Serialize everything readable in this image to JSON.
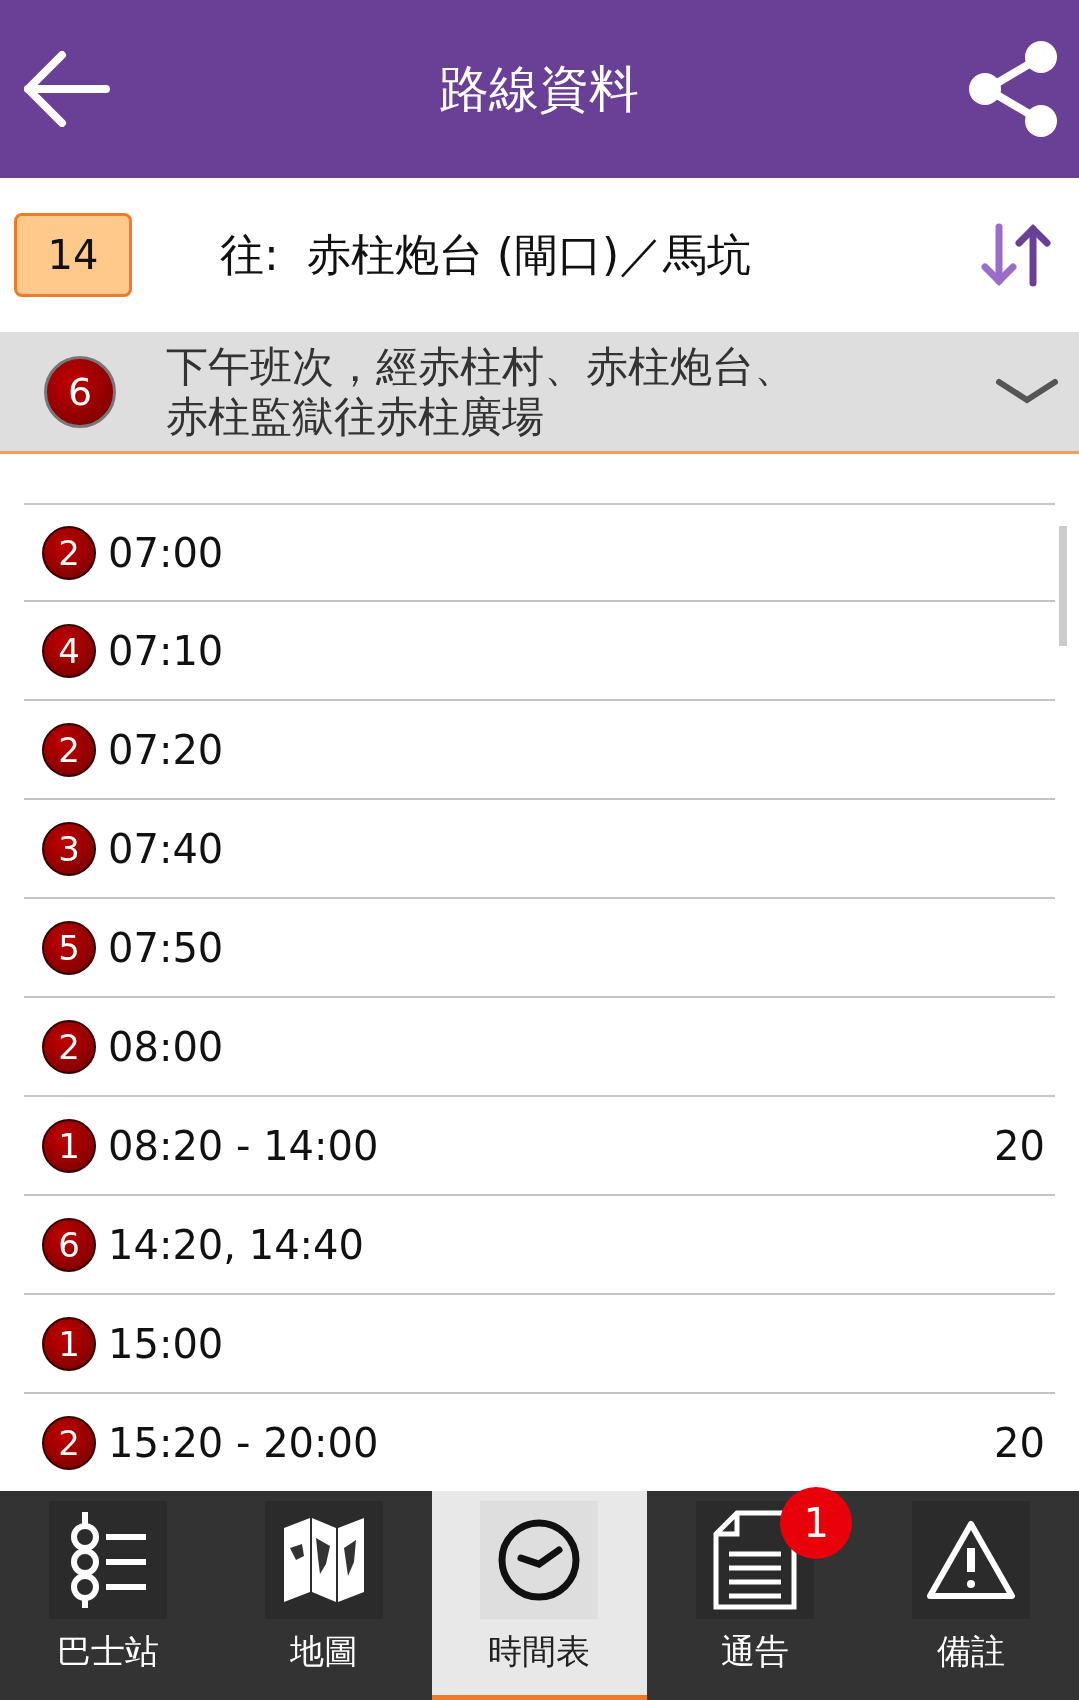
{
  "header": {
    "title": "路線資料"
  },
  "route": {
    "number": "14",
    "destination": "往:  赤柱炮台 (閘口)／馬坑"
  },
  "variant": {
    "number": "6",
    "description": [
      "下午班次，經赤柱村、赤柱炮台、",
      "赤柱監獄往赤柱廣場"
    ]
  },
  "schedule": [
    {
      "variant": "2",
      "times": "07:00"
    },
    {
      "variant": "4",
      "times": "07:10"
    },
    {
      "variant": "2",
      "times": "07:20"
    },
    {
      "variant": "3",
      "times": "07:40"
    },
    {
      "variant": "5",
      "times": "07:50"
    },
    {
      "variant": "2",
      "times": "08:00"
    },
    {
      "variant": "1",
      "times": "08:20 - 14:00",
      "frequency": "20"
    },
    {
      "variant": "6",
      "times": "14:20, 14:40"
    },
    {
      "variant": "1",
      "times": "15:00"
    },
    {
      "variant": "2",
      "times": "15:20 - 20:00",
      "frequency": "20"
    }
  ],
  "nav": [
    {
      "kind": "stops",
      "label": "巴士站",
      "selected": false
    },
    {
      "kind": "map",
      "label": "地圖",
      "selected": false
    },
    {
      "kind": "clock",
      "label": "時間表",
      "selected": true
    },
    {
      "kind": "notice",
      "label": "通告",
      "selected": false,
      "badge": "1"
    },
    {
      "kind": "warning",
      "label": "備註",
      "selected": false
    }
  ]
}
